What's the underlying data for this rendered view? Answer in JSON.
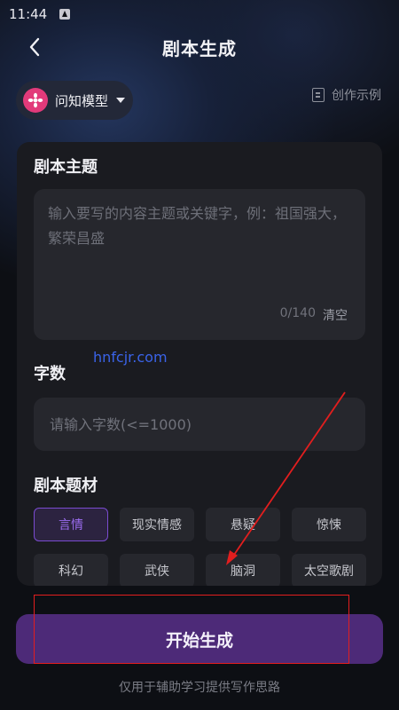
{
  "status_bar": {
    "time": "11:44"
  },
  "header": {
    "title": "剧本生成"
  },
  "model_selector": {
    "name": "问知模型"
  },
  "examples": {
    "label": "创作示例"
  },
  "topic": {
    "title": "剧本主题",
    "placeholder": "输入要写的内容主题或关键字，例：祖国强大，繁荣昌盛",
    "value": "",
    "count": "0/140",
    "clear_label": "清空"
  },
  "word_count": {
    "title": "字数",
    "placeholder": "请输入字数(<=1000)"
  },
  "genre": {
    "title": "剧本题材",
    "options": [
      "言情",
      "现实情感",
      "悬疑",
      "惊悚",
      "科幻",
      "武侠",
      "脑洞",
      "太空歌剧"
    ],
    "selected": "言情"
  },
  "watermark": "hnfcjr.com",
  "start_button": {
    "label": "开始生成"
  },
  "footer": {
    "note": "仅用于辅助学习提供写作思路"
  },
  "colors": {
    "accent_purple": "#4d2a78",
    "selected_chip_text": "#9b6cf0",
    "annotation_red": "#e21e1e",
    "logo_pink": "#e23a7a"
  }
}
